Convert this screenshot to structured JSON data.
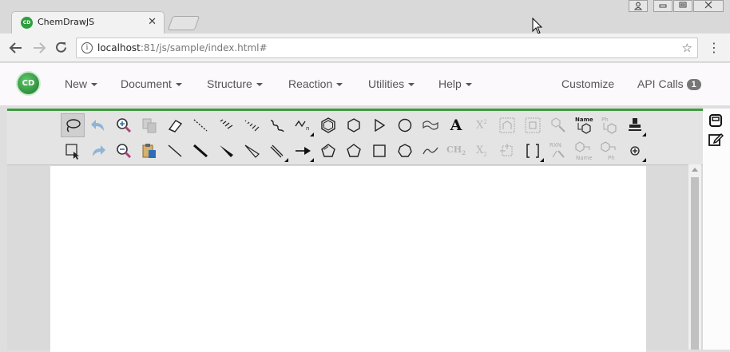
{
  "browser": {
    "tab_title": "ChemDrawJS",
    "tab_icon_text": "CD",
    "url_host": "localhost",
    "url_rest": ":81/js/sample/index.html#",
    "icons": [
      "back-icon",
      "forward-icon",
      "reload-icon",
      "info-icon",
      "star-icon",
      "menu-icon"
    ]
  },
  "app": {
    "logo_text": "CD",
    "nav": {
      "new": "New",
      "document": "Document",
      "structure": "Structure",
      "reaction": "Reaction",
      "utilities": "Utilities",
      "help": "Help"
    },
    "customize": "Customize",
    "api_calls": "API Calls",
    "api_calls_count": "1",
    "accent_color": "#3e9b3e"
  },
  "tools": {
    "text_tool": "A",
    "superscript": "X",
    "superscript_mark": "2",
    "subscript": "X",
    "subscript_mark": "2",
    "name_to_structure": "Name",
    "phenyl_top": "Ph",
    "ch2": "CH",
    "ch2_sub": "2",
    "rxn": "RXN",
    "name_label": "Name",
    "ph_label": "Ph"
  }
}
